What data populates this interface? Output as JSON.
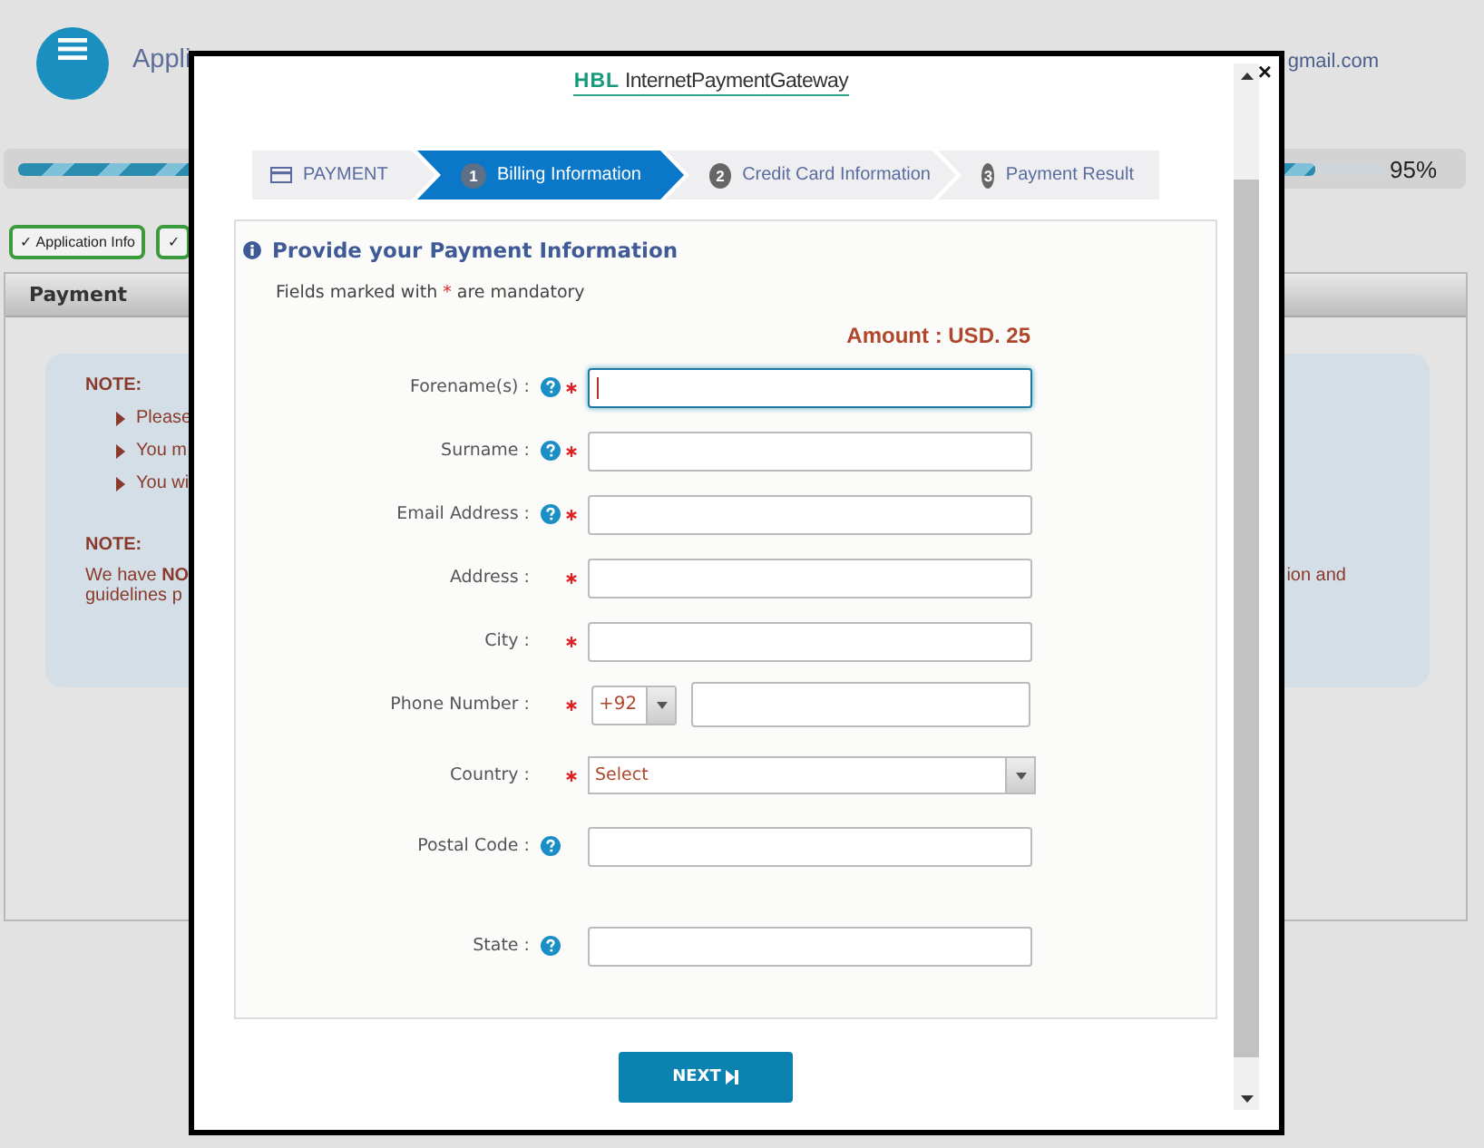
{
  "page": {
    "header": {
      "title": "Appli",
      "email": "gmail.com"
    },
    "progress": {
      "level": 0.95,
      "reading": "95%"
    },
    "tabs": [
      {
        "label": "✓ Application Info"
      },
      {
        "label": "✓"
      }
    ],
    "panel": {
      "title": "Payment",
      "notes": [
        {
          "heading": "NOTE:",
          "bullets": [
            "Please",
            "You m",
            "You wi"
          ]
        },
        {
          "heading": "NOTE:",
          "text": "We have **NO**",
          "text_right": "ion and",
          "text_2": "guidelines p"
        }
      ]
    }
  },
  "modal": {
    "close": "×",
    "logo": {
      "brand": "HBL",
      "name": "InternetPaymentGateway"
    },
    "steps": [
      {
        "kind": "icon",
        "label": "PAYMENT",
        "selected": false
      },
      {
        "kind": "numbered",
        "number": "1",
        "label": "Billing Information",
        "selected": true
      },
      {
        "kind": "numbered",
        "number": "2",
        "label": "Credit Card Information",
        "selected": false
      },
      {
        "kind": "numbered",
        "number": "3",
        "label": "Payment Result",
        "selected": false
      }
    ],
    "form": {
      "title": "Provide your Payment Information",
      "mandatory_note": {
        "before": "Fields marked with",
        "mark": "*",
        "after": "are mandatory"
      },
      "amount": "Amount : USD. 25",
      "fields": [
        {
          "kind": "text",
          "label": "Forename(s) :",
          "help": true,
          "required": true,
          "focused": true
        },
        {
          "kind": "text",
          "label": "Surname :",
          "help": true,
          "required": true,
          "focused": false
        },
        {
          "kind": "text",
          "label": "Email Address :",
          "help": true,
          "required": true,
          "focused": false
        },
        {
          "kind": "text",
          "label": "Address :",
          "help": false,
          "required": true,
          "focused": false
        },
        {
          "kind": "text",
          "label": "City :",
          "help": false,
          "required": true,
          "focused": false
        },
        {
          "kind": "phone",
          "label": "Phone Number :",
          "help": false,
          "required": true,
          "focused": false,
          "code": "+92"
        },
        {
          "kind": "select",
          "label": "Country :",
          "help": false,
          "required": true,
          "focused": false,
          "value": "Select"
        },
        {
          "kind": "text",
          "label": "Postal Code :",
          "help": true,
          "required": false,
          "focused": false
        },
        {
          "kind": "text",
          "label": "State :",
          "help": true,
          "required": false,
          "focused": false
        }
      ]
    },
    "next_button": "NEXT"
  }
}
